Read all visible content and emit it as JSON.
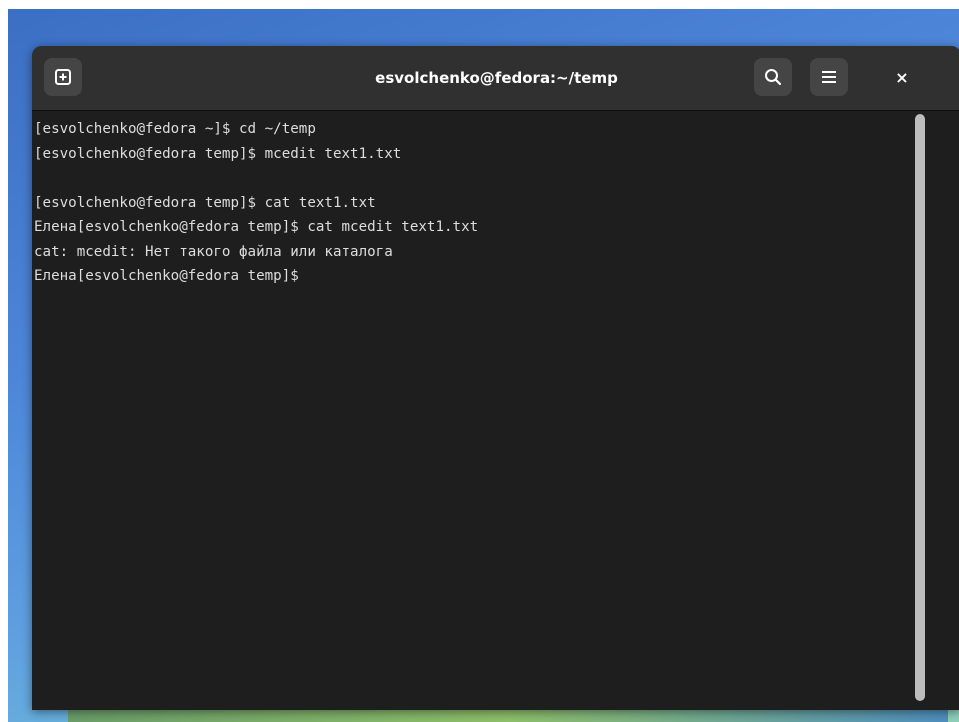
{
  "window": {
    "title": "esvolchenko@fedora:~/temp"
  },
  "titlebar": {
    "icons": {
      "new_tab": "new-tab-icon",
      "search": "search-icon",
      "menu": "hamburger-menu-icon",
      "close": "close-icon"
    },
    "close_glyph": "×"
  },
  "terminal": {
    "lines": [
      "[esvolchenko@fedora ~]$ cd ~/temp",
      "[esvolchenko@fedora temp]$ mcedit text1.txt",
      "",
      "[esvolchenko@fedora temp]$ cat text1.txt",
      "Елена[esvolchenko@fedora temp]$ cat mcedit text1.txt",
      "cat: mcedit: Нет такого файла или каталога",
      "Елена[esvolchenko@fedora temp]$ "
    ]
  },
  "colors": {
    "terminal_bg": "#1e1e1e",
    "titlebar_bg": "#303030",
    "text": "#dddddd",
    "button_bg": "#454545",
    "scrollbar_thumb": "#bdbdbd"
  }
}
